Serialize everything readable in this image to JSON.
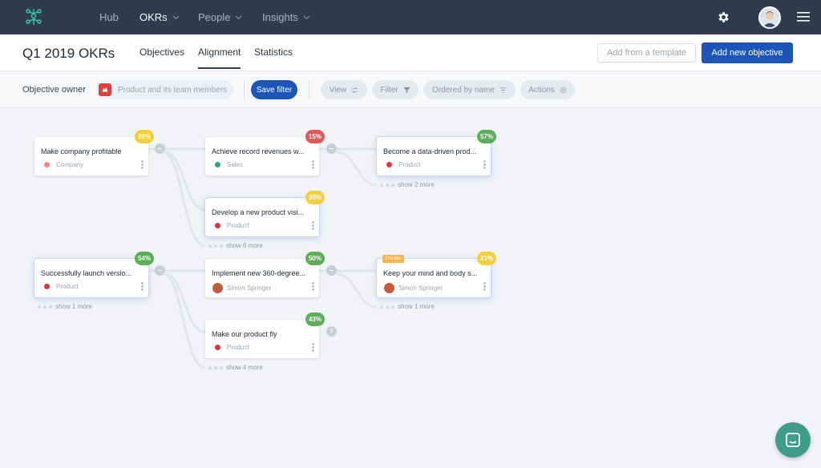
{
  "nav": {
    "items": [
      {
        "label": "Hub",
        "has_dropdown": false,
        "active": false
      },
      {
        "label": "OKRs",
        "has_dropdown": true,
        "active": true
      },
      {
        "label": "People",
        "has_dropdown": true,
        "active": false
      },
      {
        "label": "Insights",
        "has_dropdown": true,
        "active": false
      }
    ],
    "icons": {
      "logo": "okr-tree-logo",
      "settings": "gear-icon",
      "menu": "hamburger-icon",
      "avatar": "user-avatar"
    }
  },
  "header": {
    "title": "Q1 2019 OKRs",
    "tabs": [
      {
        "label": "Objectives",
        "active": false
      },
      {
        "label": "Alignment",
        "active": true
      },
      {
        "label": "Statistics",
        "active": false
      }
    ],
    "add_from_template": "Add from a template",
    "add_new_objective": "Add new objective"
  },
  "filters": {
    "owner_label": "Objective owner",
    "owner_value": "Product and its team members",
    "save_filter": "Save filter",
    "view": "View",
    "filter": "Filter",
    "ordered_by": "Ordered by name",
    "actions": "Actions"
  },
  "objectives": [
    {
      "id": "o1",
      "title": "Make company profitable",
      "owner": "Company",
      "owner_color": "#ef8f7a",
      "progress": "29%",
      "badge_color": "#f5cf3b"
    },
    {
      "id": "o2",
      "title": "Achieve record revenues w...",
      "owner": "Sales",
      "owner_color": "#3f9c8b",
      "progress": "15%",
      "badge_color": "#e25757"
    },
    {
      "id": "o3",
      "title": "Become a data-driven prod...",
      "owner": "Product",
      "owner_color": "#e0353d",
      "progress": "57%",
      "badge_color": "#5cae5a"
    },
    {
      "id": "o4",
      "title": "Develop a new product visi...",
      "owner": "Product",
      "owner_color": "#e0353d",
      "progress": "30%",
      "badge_color": "#f5cf3b"
    },
    {
      "id": "o5",
      "title": "Successfully launch versio...",
      "owner": "Product",
      "owner_color": "#e0353d",
      "progress": "54%",
      "badge_color": "#5cae5a"
    },
    {
      "id": "o6",
      "title": "Implement new 360-degree...",
      "owner": "Simon Springer",
      "owner_color": "avatar",
      "progress": "50%",
      "badge_color": "#5cae5a"
    },
    {
      "id": "o7",
      "title": "Keep your mind and body s...",
      "owner": "Simon Springer",
      "owner_color": "avatar",
      "progress": "21%",
      "badge_color": "#f5cf3b",
      "tag": "Private"
    },
    {
      "id": "o8",
      "title": "Make our product fly",
      "owner": "Product",
      "owner_color": "#e0353d",
      "progress": "43%",
      "badge_color": "#5cae5a",
      "child_count": "3"
    }
  ],
  "show_more": {
    "o3": "show 2 more",
    "o4": "show 6 more",
    "o5": "show 1 more",
    "o7": "show 1 more",
    "o8": "show 4 more"
  },
  "colors": {
    "nav_bg": "#2e3c4e",
    "primary": "#1c55b7",
    "chat": "#3f9c8b"
  }
}
